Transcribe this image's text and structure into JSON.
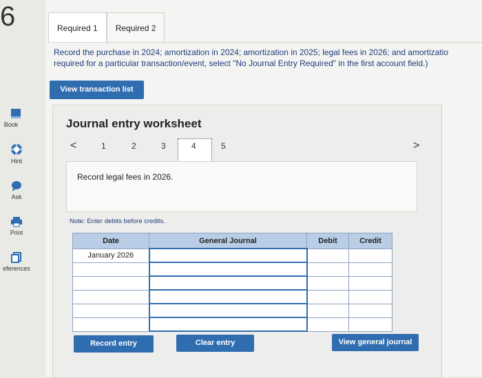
{
  "question_number": "6",
  "tabs": [
    "Required 1",
    "Required 2"
  ],
  "instructions": {
    "line1": "Record the purchase in 2024; amortization in 2024; amortization in 2025; legal fees in 2026; and amortizatio",
    "line2": "required for a particular transaction/event, select \"No Journal Entry Required\" in the first account field.)"
  },
  "view_transaction_label": "View transaction list",
  "worksheet": {
    "title": "Journal entry worksheet",
    "prev_glyph": "<",
    "next_glyph": ">",
    "pages": [
      "1",
      "2",
      "3",
      "4",
      "5"
    ],
    "current_page": "4",
    "step_text": "Record legal fees in 2026.",
    "note": "Note: Enter debits before credits."
  },
  "table": {
    "headers": [
      "Date",
      "General Journal",
      "Debit",
      "Credit"
    ],
    "first_date": "January 2026"
  },
  "buttons": {
    "record_entry": "Record entry",
    "clear_entry": "Clear entry",
    "view_general_journal": "View general journal"
  },
  "sidebar": {
    "items": [
      {
        "label": "Book",
        "icon": "book-icon"
      },
      {
        "label": "Hint",
        "icon": "hint-icon"
      },
      {
        "label": "Ask",
        "icon": "ask-icon"
      },
      {
        "label": "Print",
        "icon": "print-icon"
      },
      {
        "label": "eferences",
        "icon": "references-icon"
      }
    ]
  },
  "colors": {
    "accent": "#2f6db0",
    "header_fill": "#b9cde6",
    "instruction_text": "#1f3b7a"
  }
}
